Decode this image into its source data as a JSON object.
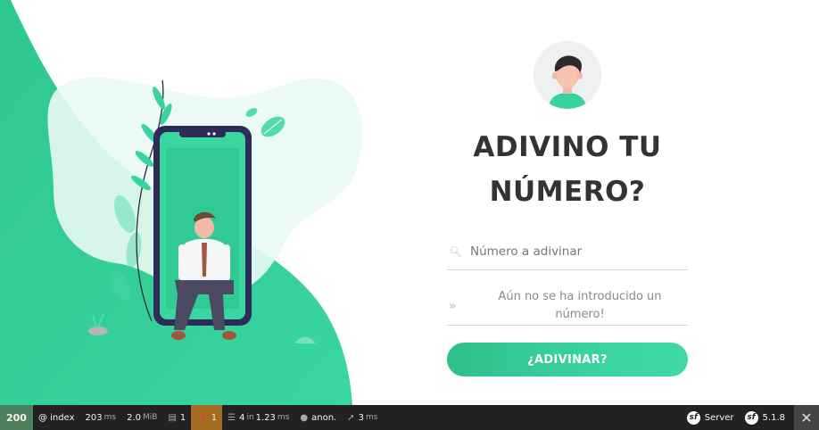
{
  "form": {
    "title": "ADIVINO TU NÚMERO?",
    "input_placeholder": "Número a adivinar",
    "result_text": "Aún no se ha introducido un número!",
    "submit_label": "¿ADIVINAR?"
  },
  "icons": {
    "search": "search-icon",
    "arrows": "double-chevron-right-icon"
  },
  "toolbar": {
    "status_code": "200",
    "route": "@ index",
    "time_value": "203",
    "time_unit": "ms",
    "memory_value": "2.0",
    "memory_unit": "MiB",
    "logs_count": "1",
    "warnings_count": "1",
    "twig_value": "4",
    "twig_in": "in",
    "twig_time": "1.23",
    "twig_unit": "ms",
    "user": "anon.",
    "ajax_value": "3",
    "ajax_unit": "ms",
    "server_label": "Server",
    "version": "5.1.8"
  },
  "colors": {
    "accent": "#38d39f",
    "toolbar_bg": "#222222",
    "status_ok": "#4f805d",
    "warning": "#a46a1f",
    "phone": "#2e2a59"
  }
}
